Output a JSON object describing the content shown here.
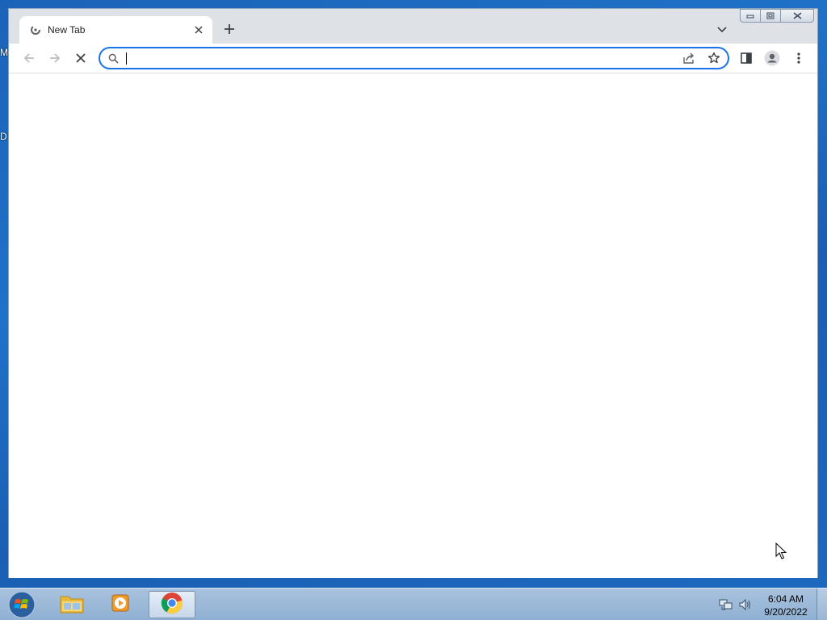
{
  "desktop": {
    "edge_labels": [
      "M",
      "D"
    ]
  },
  "browser": {
    "tab": {
      "title": "New Tab"
    },
    "omnibox": {
      "value": "",
      "placeholder": ""
    },
    "accent_color": "#1a73e8"
  },
  "taskbar": {
    "pinned": [
      {
        "name": "windows-explorer",
        "icon": "folder-icon"
      },
      {
        "name": "media-player",
        "icon": "media-player-icon"
      },
      {
        "name": "google-chrome",
        "icon": "chrome-icon",
        "active": true
      }
    ],
    "clock": {
      "time": "6:04 AM",
      "date": "9/20/2022"
    }
  }
}
